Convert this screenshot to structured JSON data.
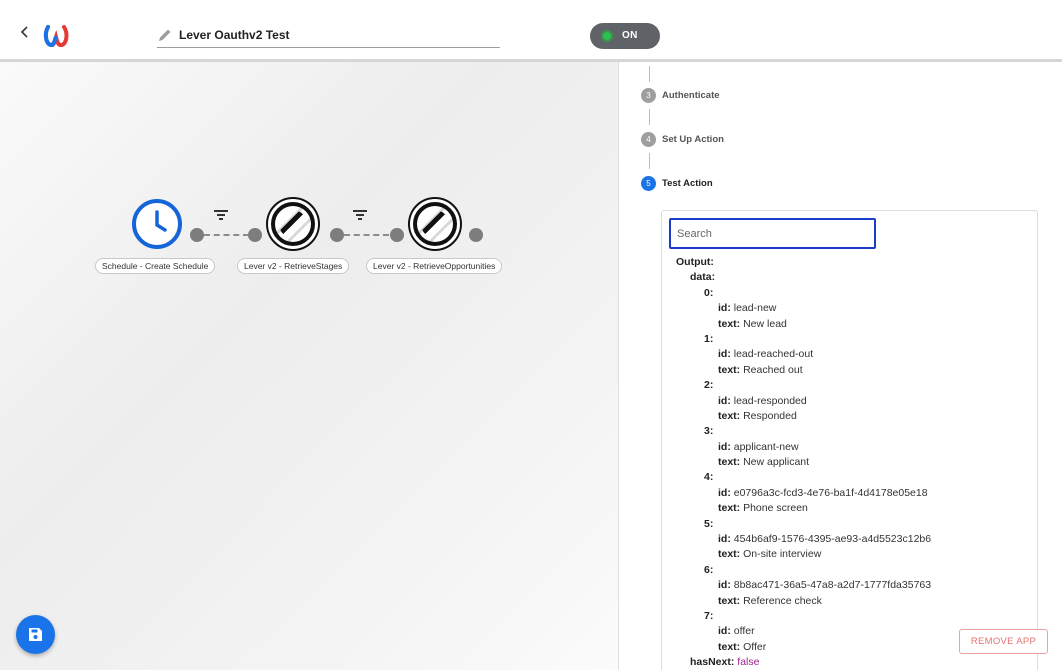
{
  "header": {
    "title": "Lever Oauthv2 Test",
    "toggle_label": "ON"
  },
  "workflow": {
    "nodes": [
      {
        "label": "Schedule - Create Schedule",
        "icon": "clock-icon"
      },
      {
        "label": "Lever v2 - RetrieveStages",
        "icon": "lever-icon"
      },
      {
        "label": "Lever v2 - RetrieveOpportunities",
        "icon": "lever-icon"
      }
    ]
  },
  "steps": [
    {
      "number": "3",
      "label": "Authenticate"
    },
    {
      "number": "4",
      "label": "Set Up Action"
    },
    {
      "number": "5",
      "label": "Test Action"
    }
  ],
  "search": {
    "placeholder": "Search"
  },
  "output": {
    "root_key": "Output:",
    "data_key": "data:",
    "items": [
      {
        "index": "0:",
        "id": "lead-new",
        "text": "New lead"
      },
      {
        "index": "1:",
        "id": "lead-reached-out",
        "text": "Reached out"
      },
      {
        "index": "2:",
        "id": "lead-responded",
        "text": "Responded"
      },
      {
        "index": "3:",
        "id": "applicant-new",
        "text": "New applicant"
      },
      {
        "index": "4:",
        "id": "e0796a3c-fcd3-4e76-ba1f-4d4178e05e18",
        "text": "Phone screen"
      },
      {
        "index": "5:",
        "id": "454b6af9-1576-4395-ae93-a4d5523c12b6",
        "text": "On-site interview"
      },
      {
        "index": "6:",
        "id": "8b8ac471-36a5-47a8-a2d7-1777fda35763",
        "text": "Reference check"
      },
      {
        "index": "7:",
        "id": "offer",
        "text": "Offer"
      }
    ],
    "id_key": "id:",
    "text_key": "text:",
    "has_next_key": "hasNext:",
    "has_next_value": "false"
  },
  "remove_button": "REMOVE APP",
  "colors": {
    "accent": "#1a73e8",
    "toggle_on": "#2bc24f",
    "remove": "#e57373",
    "boolean_value": "#a0218c"
  }
}
